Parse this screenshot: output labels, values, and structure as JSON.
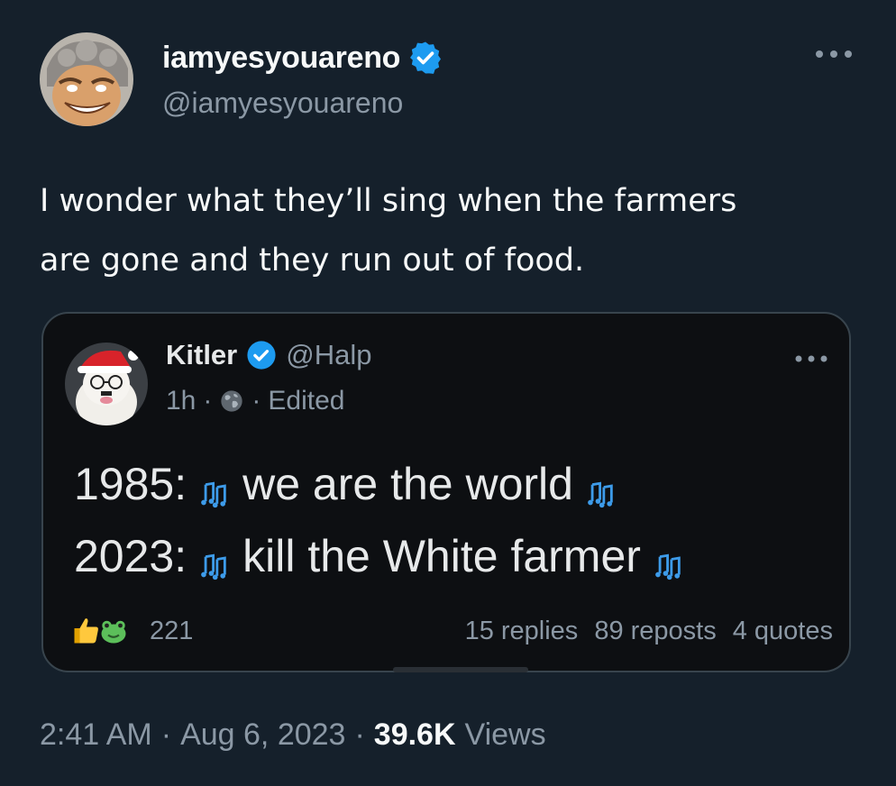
{
  "author": {
    "display_name": "iamyesyouareno",
    "handle": "@iamyesyouareno"
  },
  "icons": {
    "verified": "verified-badge-icon",
    "more": "more-horizontal-icon",
    "globe": "globe-icon",
    "music_note": "music-notes-icon",
    "reactions": [
      "thumbs-up-emoji",
      "frog-emoji"
    ]
  },
  "tweet": {
    "text_line1": "I wonder what they’ll sing when the farmers",
    "text_line2": "are gone and they run out of food."
  },
  "quote": {
    "display_name": "Kitler",
    "handle": "@Halp",
    "time": "1h",
    "sep1": "·",
    "sep2": "·",
    "edited": "Edited",
    "line1_prefix": "1985:",
    "line1_text": "we are the world",
    "line2_prefix": "2023:",
    "line2_text": "kill the White farmer",
    "reaction_count": "221",
    "replies": "15 replies",
    "reposts": "89 reposts",
    "quotes": "4 quotes"
  },
  "footer": {
    "time": "2:41 AM",
    "sep1": "·",
    "date": "Aug 6, 2023",
    "sep2": "·",
    "views_count": "39.6K",
    "views_label": "Views"
  },
  "colors": {
    "background": "#15202b",
    "quote_background": "#0d0f12",
    "verified_blue": "#1d9bf0",
    "secondary_text": "#8b98a5",
    "note_blue": "#3d9be9"
  }
}
